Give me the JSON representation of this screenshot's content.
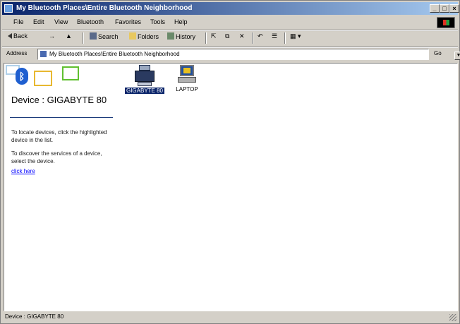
{
  "window": {
    "title": "My Bluetooth Places\\Entire Bluetooth Neighborhood",
    "controls": {
      "minimize": "_",
      "maximize": "□",
      "close": "×"
    }
  },
  "menubar": {
    "items": [
      "File",
      "Edit",
      "View",
      "Bluetooth",
      "Favorites",
      "Tools",
      "Help"
    ]
  },
  "toolbar": {
    "back_label": "Back",
    "search_label": "Search",
    "folders_label": "Folders",
    "history_label": "History"
  },
  "address": {
    "label": "Address",
    "value": "My Bluetooth Places\\Entire Bluetooth Neighborhood",
    "go_label": "Go"
  },
  "pane": {
    "title": "Device : GIGABYTE 80",
    "text1": "To locate devices, click the highlighted device in the list.",
    "text2": "To discover the services of a device, select the device.",
    "link": "click here"
  },
  "devices": [
    {
      "name": "GIGABYTE 80",
      "icon": "printer-icon",
      "selected": true
    },
    {
      "name": "LAPTOP",
      "icon": "laptop-icon",
      "selected": false
    }
  ],
  "status": {
    "text": "Device : GIGABYTE 80"
  },
  "colors": {
    "title_start": "#0a246a",
    "title_end": "#a6caf0",
    "selection": "#0a246a",
    "link": "#0000ff",
    "chrome": "#d4d0c8"
  }
}
